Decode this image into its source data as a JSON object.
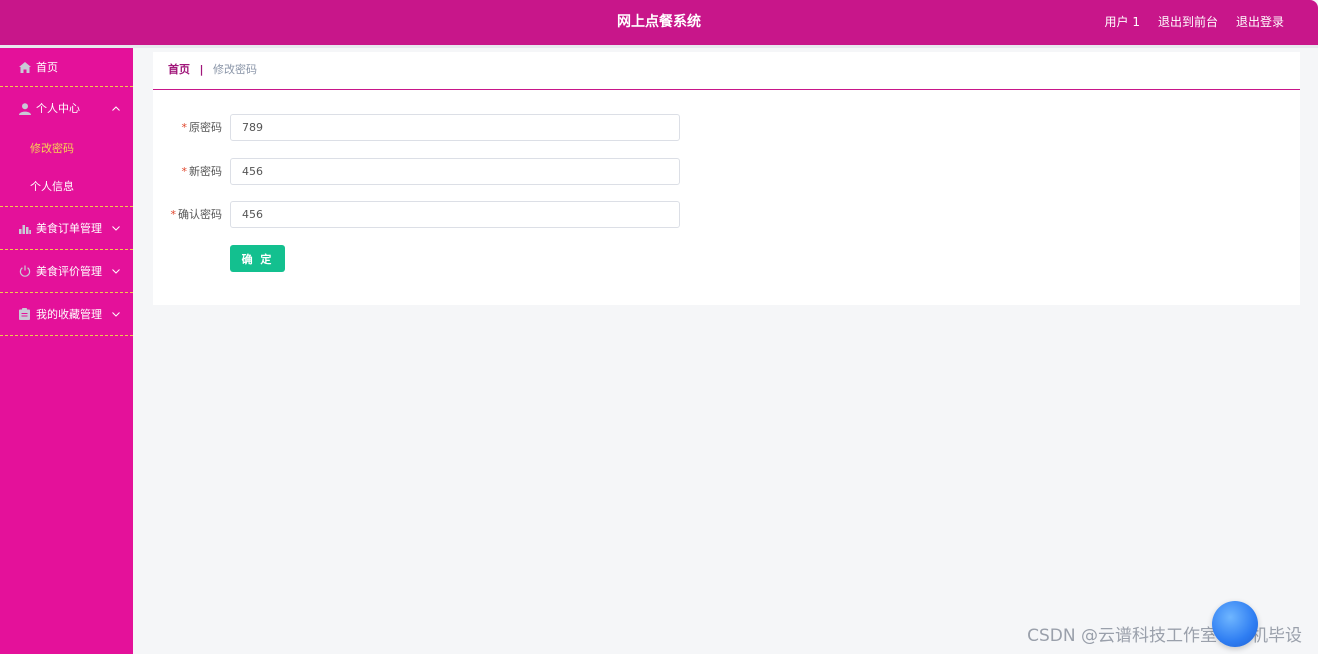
{
  "header": {
    "title": "网上点餐系统",
    "user": "用户 1",
    "back_front": "退出到前台",
    "logout": "退出登录"
  },
  "sidebar": {
    "items": [
      {
        "label": "首页",
        "icon": "home-icon"
      },
      {
        "label": "个人中心",
        "icon": "user-icon",
        "expanded": true,
        "children": [
          {
            "label": "修改密码",
            "active": true
          },
          {
            "label": "个人信息",
            "active": false
          }
        ]
      },
      {
        "label": "美食订单管理",
        "icon": "bar-chart-icon"
      },
      {
        "label": "美食评价管理",
        "icon": "power-icon"
      },
      {
        "label": "我的收藏管理",
        "icon": "clipboard-icon"
      }
    ]
  },
  "breadcrumb": {
    "home": "首页",
    "separator": "|",
    "current": "修改密码"
  },
  "form": {
    "old_password": {
      "label": "原密码",
      "value": "789"
    },
    "new_password": {
      "label": "新密码",
      "value": "456"
    },
    "confirm_password": {
      "label": "确认密码",
      "value": "456"
    },
    "required_mark": "*",
    "submit_label": "确 定"
  },
  "watermark": "CSDN @云谱科技工作室计算机毕设",
  "colors": {
    "header": "#c8168a",
    "sidebar": "#e4119a",
    "active_submenu": "#f7d154",
    "submit_button": "#13c08f"
  }
}
